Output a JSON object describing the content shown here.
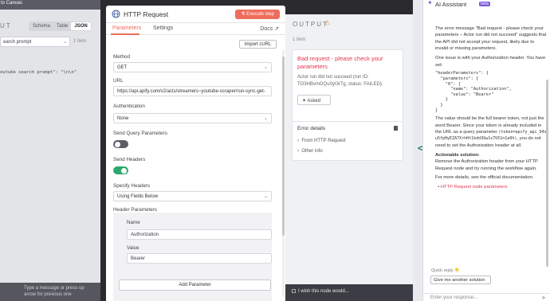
{
  "left_panel": {
    "back_label": "to Canvas",
    "section_label": "UT",
    "view_modes": [
      "Schema",
      "Table",
      "JSON"
    ],
    "field_select": "earch prompt",
    "item_count": "1 item",
    "json_line": "outube search prompt\": \"\\n\\n\"",
    "footer_line1": "Type a message or press up",
    "footer_line2": "arrow for previous one"
  },
  "http_request": {
    "title": "HTTP Request",
    "execute_label": "Execute step",
    "tabs": [
      "Parameters",
      "Settings"
    ],
    "docs_label": "Docs",
    "import_curl": "Import cURL",
    "method_label": "Method",
    "method_value": "GET",
    "url_label": "URL",
    "url_value": "https://api.apify.com/v2/acts/streamers~youtube-scraper/run-sync-get-",
    "auth_label": "Authentication",
    "auth_value": "None",
    "send_query_label": "Send Query Parameters",
    "send_headers_label": "Send Headers",
    "specify_headers_label": "Specify Headers",
    "specify_headers_value": "Using Fields Below",
    "header_params_label": "Header Parameters",
    "name_label": "Name",
    "name_value": "Authorization",
    "value_label": "Value",
    "value_value": "Bearer",
    "add_param_label": "Add Parameter"
  },
  "output": {
    "title": "OUTPUT",
    "item_count": "1 item",
    "error_title": "Bad request - please check your parameters",
    "error_desc": "Actor run did not succeed (run ID: TO3HBvmGQu0yI3r7g, status: FAILED).",
    "asked_label": "Asked",
    "details_title": "Error details",
    "details_rows": [
      "From HTTP Request",
      "Other info"
    ],
    "footer_text": "I wish this node would..."
  },
  "ai_assistant": {
    "title": "AI Assistant",
    "beta": "beta",
    "p1": "The error message \"Bad request - please check your parameters – Actor run did not succeed\" suggests that the API did not accept your request, likely due to invalid or missing parameters.",
    "p2": "One issue is with your Authorization header. You have set:",
    "code": "\"headerParameters\": {\n  \"parameters\": {\n    \"0\": {\n      \"name\": \"Authorization\",\n      \"value\": \"Bearer\"\n    }\n  }\n}",
    "p3a": "The value should be the full bearer token, not just the word Bearer. Since your token is already included in the URL as a query parameter",
    "p3code": "(token=apify_api_D4xu5fpHyEZA7XrhHt1kdd3Gw1x7U51n1a0h)",
    "p3b": ", you do not need to set the Authorization header at all.",
    "actionable_title": "Actionable solution:",
    "actionable_text": "Remove the Authorization header from your HTTP Request node and try running the workflow again.",
    "more_text": "For more details, see the official documentation:",
    "doc_link": "HTTP Request node parameters",
    "quick_reply_label": "Quick reply 👇",
    "quick_reply_button": "Give me another solution",
    "input_placeholder": "Enter your response..."
  }
}
